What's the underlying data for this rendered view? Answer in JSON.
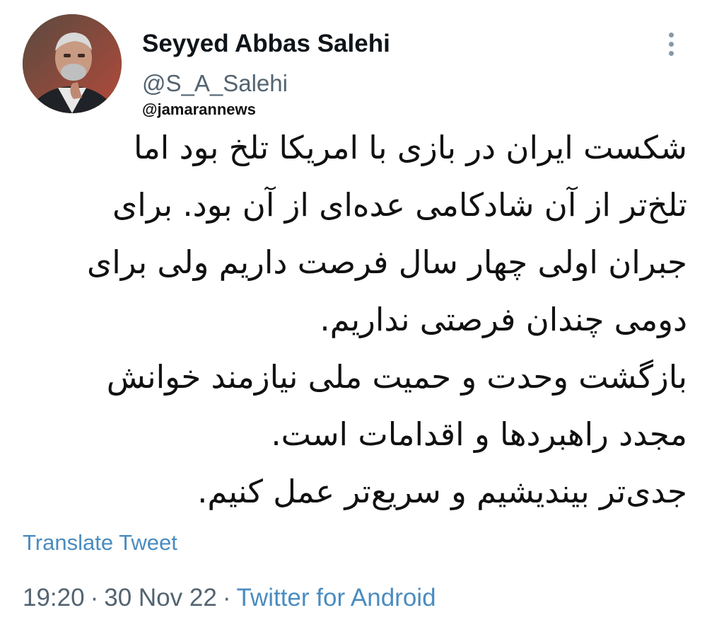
{
  "author": {
    "display_name": "Seyyed Abbas Salehi",
    "handle": "@S_A_Salehi"
  },
  "watermark": "@jamarannews",
  "tweet": {
    "lines": [
      "شکست ایران در بازی با امریکا تلخ بود اما",
      "تلخ‌تر از آن شادکامی عده‌ای از آن بود. برای",
      "جبران اولی چهار سال فرصت داریم ولی برای",
      "دومی چندان فرصتی نداریم.",
      "بازگشت وحدت و حمیت ملی نیازمند خوانش",
      "مجدد راهبردها و اقدامات است.",
      "جدی‌تر بیندیشیم و سریع‌تر عمل کنیم."
    ]
  },
  "translate_label": "Translate Tweet",
  "meta": {
    "time": "19:20",
    "date": "30 Nov 22",
    "separator": "·",
    "source": "Twitter for Android"
  },
  "icons": {
    "more": "more-vertical-icon"
  },
  "colors": {
    "link": "#4a8cc0",
    "secondary_text": "#536471",
    "primary_text": "#0f1419"
  }
}
